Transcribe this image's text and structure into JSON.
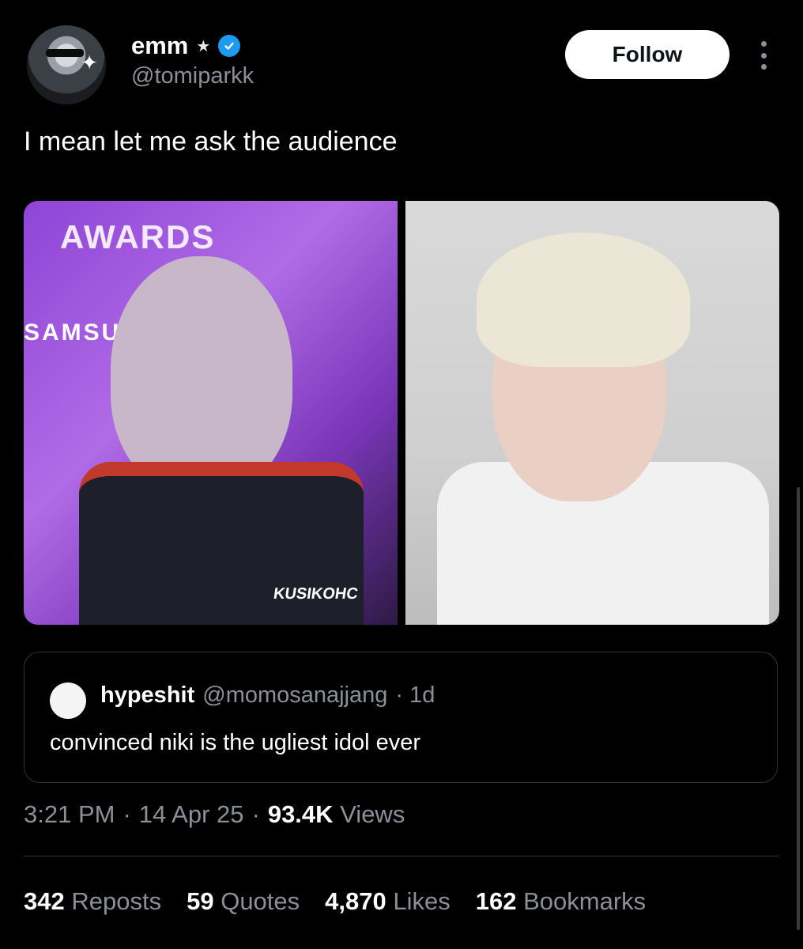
{
  "author": {
    "name": "emm",
    "name_star": "★",
    "handle": "@tomiparkk",
    "follow_label": "Follow"
  },
  "tweet": {
    "text": "I mean let me ask the audience"
  },
  "media": {
    "left": {
      "awards_text": "AWARDS",
      "samsung_text": "SAMSU",
      "mic_text": "KUSIKOHC"
    },
    "right": {}
  },
  "quote": {
    "name": "hypeshit",
    "handle": "@momosanajjang",
    "age": "· 1d",
    "text": "convinced niki is the ugliest idol ever"
  },
  "meta": {
    "time": "3:21 PM",
    "sep1": "·",
    "date": "14 Apr 25",
    "sep2": "·",
    "views_count": "93.4K",
    "views_label": "Views"
  },
  "stats": [
    {
      "count": "342",
      "label": "Reposts"
    },
    {
      "count": "59",
      "label": "Quotes"
    },
    {
      "count": "4,870",
      "label": "Likes"
    },
    {
      "count": "162",
      "label": "Bookmarks"
    }
  ],
  "colors": {
    "verified": "#1d9bf0",
    "muted": "#8b9096",
    "border": "#2f3336"
  }
}
